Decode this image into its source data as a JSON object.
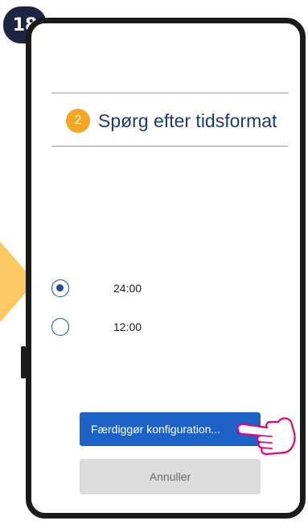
{
  "step": {
    "number": "18"
  },
  "header": {
    "step_index": "2",
    "title": "Spørg efter tidsformat"
  },
  "time_format": {
    "options": [
      {
        "label": "24:00",
        "selected": true
      },
      {
        "label": "12:00",
        "selected": false
      }
    ]
  },
  "buttons": {
    "finish_label": "Færdiggør konfiguration...",
    "cancel_label": "Annuller"
  },
  "colors": {
    "accent": "#1c62c7",
    "badge": "#f5a623",
    "arrow": "#fcc862",
    "hand": "#e6007e"
  },
  "icons": {
    "pointer": "hand-pointer-icon",
    "arrow": "right-arrow-icon"
  }
}
